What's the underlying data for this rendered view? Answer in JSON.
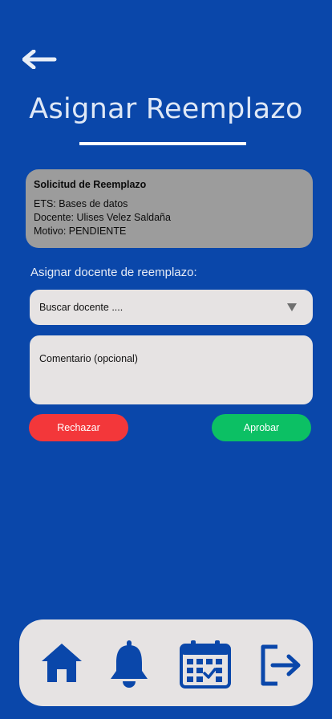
{
  "header": {
    "title": "Asignar Reemplazo"
  },
  "request": {
    "title": "Solicitud de Reemplazo",
    "ets": "ETS: Bases de datos",
    "docente": "Docente: Ulises Velez Saldaña",
    "motivo": "Motivo: PENDIENTE"
  },
  "assign": {
    "label": "Asignar docente de reemplazo:",
    "search_value": "Buscar docente ...."
  },
  "comment": {
    "placeholder": "Comentario (opcional)"
  },
  "actions": {
    "reject_label": "Rechazar",
    "approve_label": "Aprobar"
  },
  "nav": {
    "items": [
      {
        "icon": "home-icon"
      },
      {
        "icon": "bell-icon"
      },
      {
        "icon": "calendar-icon"
      },
      {
        "icon": "logout-icon"
      }
    ]
  },
  "colors": {
    "background": "#0a47aa",
    "card": "#9c9c9c",
    "field": "#e6e3e3",
    "reject": "#f3373a",
    "approve": "#0cc064",
    "nav_icon": "#0a47aa"
  }
}
